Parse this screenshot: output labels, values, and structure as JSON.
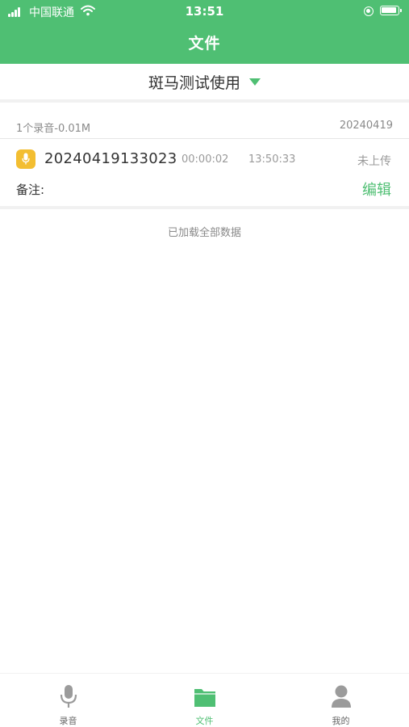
{
  "status_bar": {
    "carrier": "中国联通",
    "time": "13:51"
  },
  "header": {
    "title": "文件"
  },
  "project": {
    "name": "斑马测试使用"
  },
  "group": {
    "summary": "1个录音-0.01M",
    "date": "20240419"
  },
  "recording": {
    "name": "20240419133023",
    "duration": "00:00:02",
    "time": "13:50:33",
    "upload_status": "未上传",
    "note_label": "备注:",
    "edit_label": "编辑"
  },
  "list_footer": "已加载全部数据",
  "tabs": [
    {
      "label": "录音",
      "icon": "microphone-icon",
      "active": false
    },
    {
      "label": "文件",
      "icon": "folder-icon",
      "active": true
    },
    {
      "label": "我的",
      "icon": "user-icon",
      "active": false
    }
  ],
  "colors": {
    "primary": "#4fbf73",
    "mic_badge": "#f3be31",
    "inactive_icon": "#9b9b9b"
  }
}
